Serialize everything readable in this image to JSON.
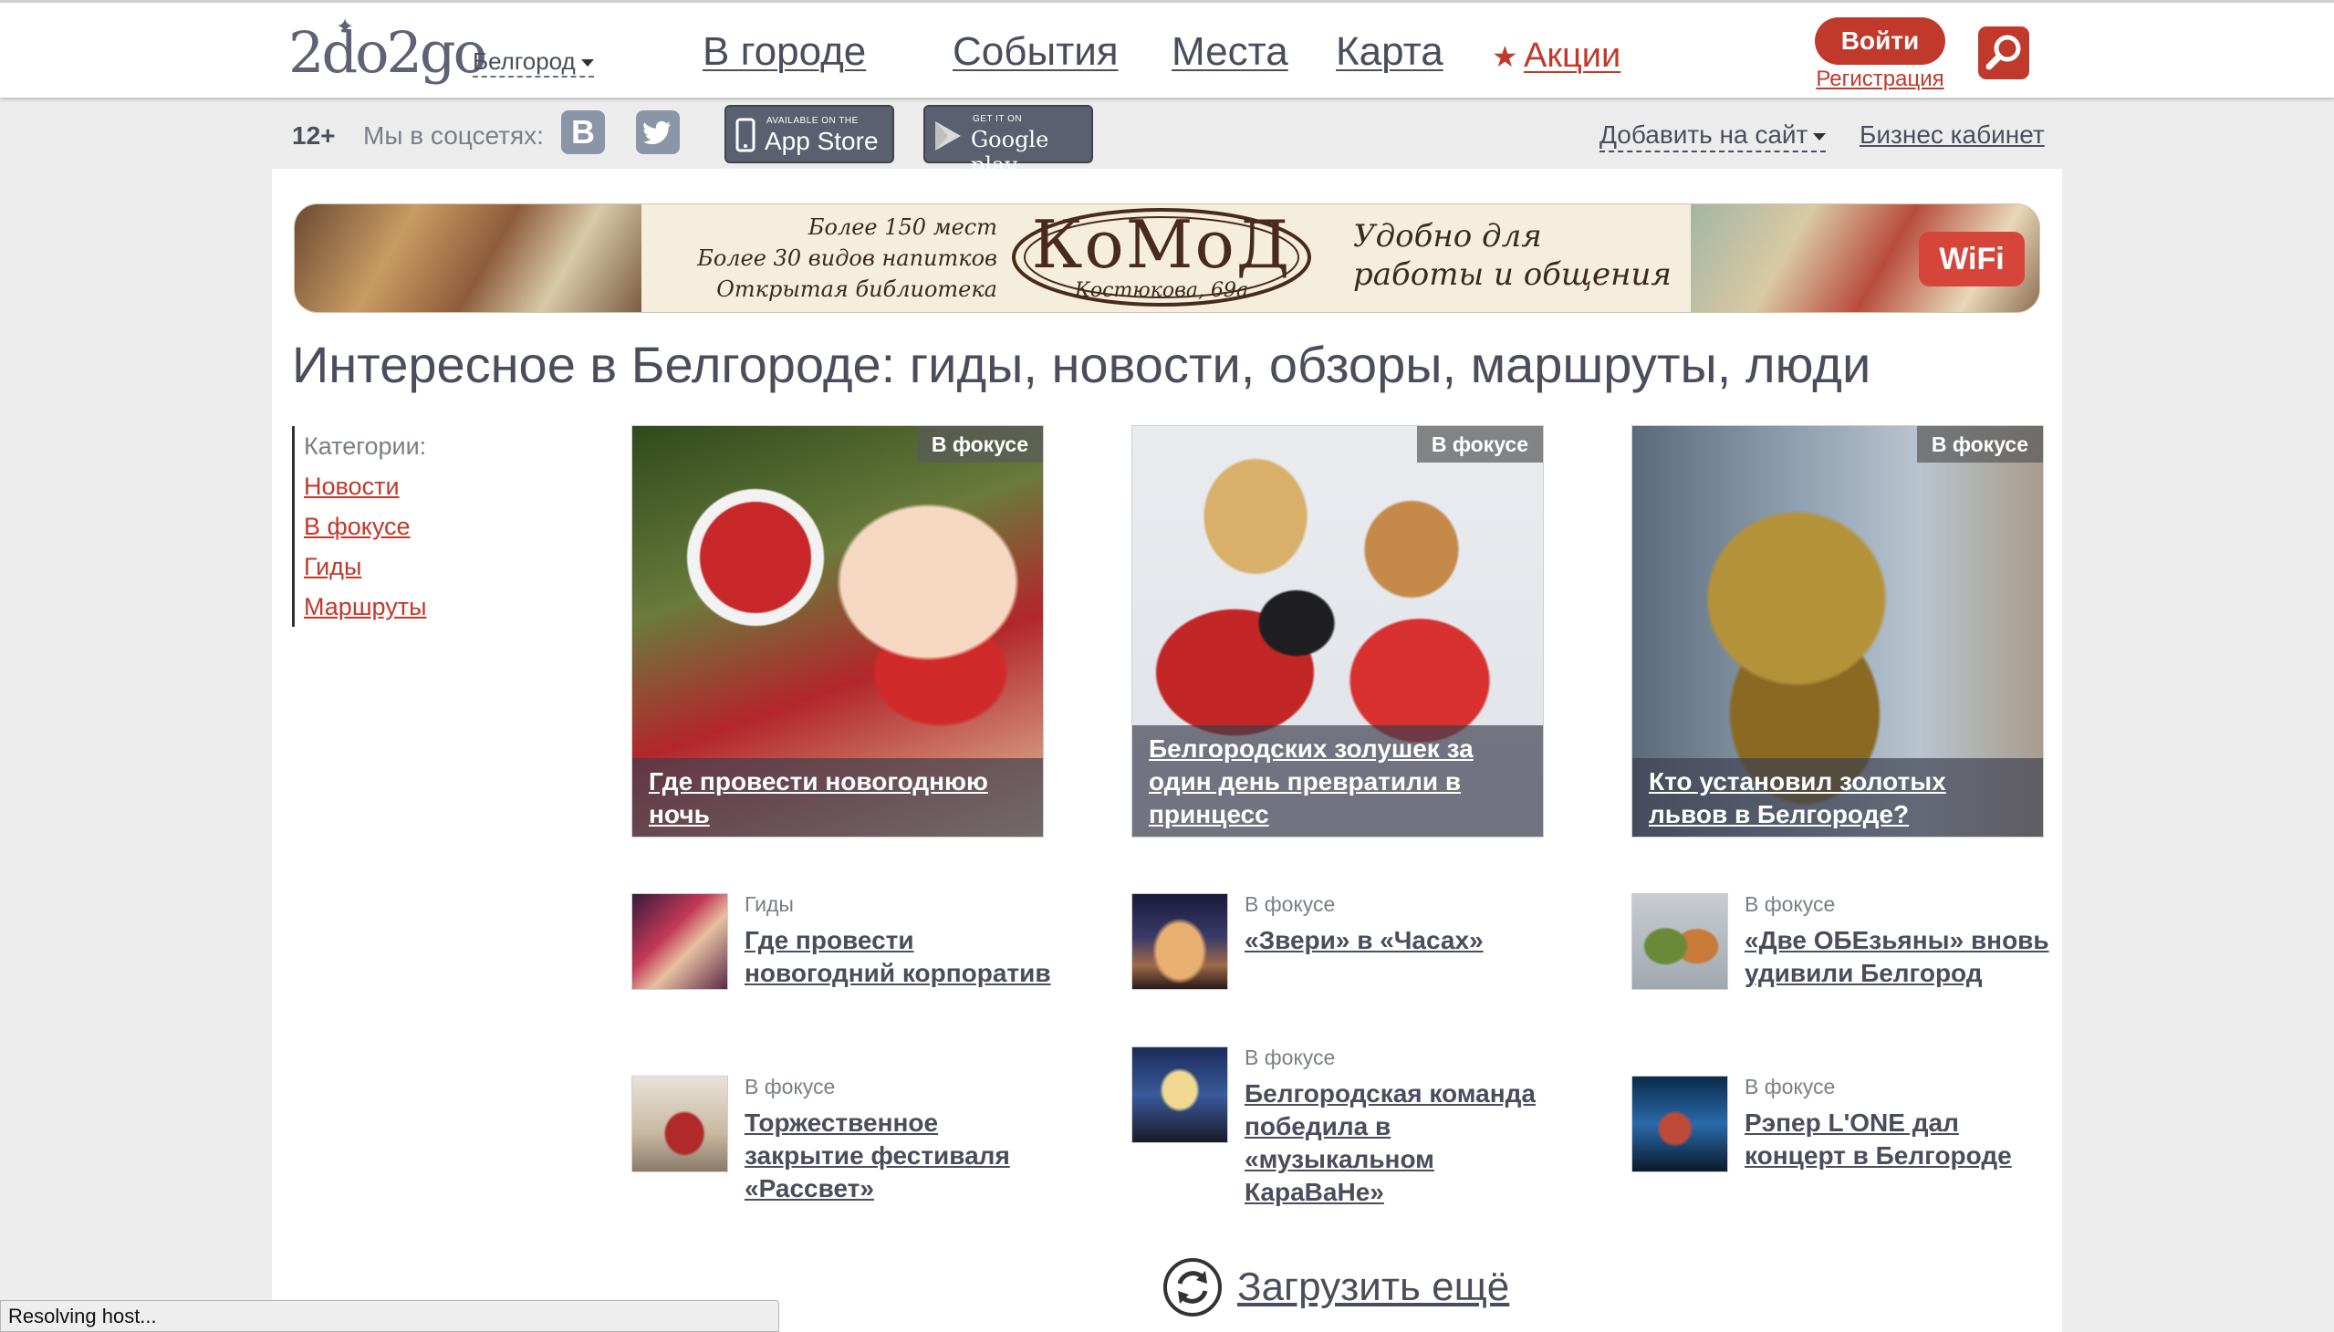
{
  "header": {
    "logo_text": "2do2go",
    "city": "Белгород",
    "nav": [
      "В городе",
      "События",
      "Места",
      "Карта"
    ],
    "promo": "Акции",
    "login": "Войти",
    "register": "Регистрация",
    "accent_color": "#c0392b"
  },
  "subbar": {
    "age_rating": "12+",
    "social_label": "Мы в соцсетях:",
    "social_icons": [
      "vk-icon",
      "twitter-icon"
    ],
    "appstore_small": "AVAILABLE ON THE",
    "appstore_big": "App Store",
    "googleplay_small": "GET IT ON",
    "googleplay_big": "Google play",
    "add_to_site": "Добавить на сайт",
    "business": "Бизнес кабинет"
  },
  "banner": {
    "features": [
      "Более 150 мест",
      "Более 30 видов напитков",
      "Открытая библиотека"
    ],
    "brand": "КоМоД",
    "address": "Костюкова, 69а",
    "slogan": "Удобно для работы и общения",
    "wifi": "WiFi"
  },
  "page_title": "Интересное в Белгороде: гиды, новости, обзоры, маршруты, люди",
  "categories": {
    "label": "Категории:",
    "items": [
      "Новости",
      "В фокусе",
      "Гиды",
      "Маршруты"
    ]
  },
  "featured": [
    {
      "tag": "В фокусе",
      "title": "Где провести новогоднюю ночь"
    },
    {
      "tag": "В фокусе",
      "title": "Белгородских золушек за один день превратили в принцесс"
    },
    {
      "tag": "В фокусе",
      "title": "Кто установил золотых львов в Белгороде?"
    }
  ],
  "news": [
    {
      "category": "Гиды",
      "title": "Где провести новогодний корпоратив"
    },
    {
      "category": "В фокусе",
      "title": "«Звери» в «Часах»"
    },
    {
      "category": "В фокусе",
      "title": "«Две ОБЕзьяны» вновь удивили Белгород"
    },
    {
      "category": "В фокусе",
      "title": "Торжественное закрытие фестиваля «Рассвет»"
    },
    {
      "category": "В фокусе",
      "title": "Белгородская команда победила в «музыкальном КараВаНе»"
    },
    {
      "category": "В фокусе",
      "title": "Рэпер L'ONE дал концерт в Белгороде"
    }
  ],
  "load_more": "Загрузить ещё",
  "status": "Resolving host..."
}
